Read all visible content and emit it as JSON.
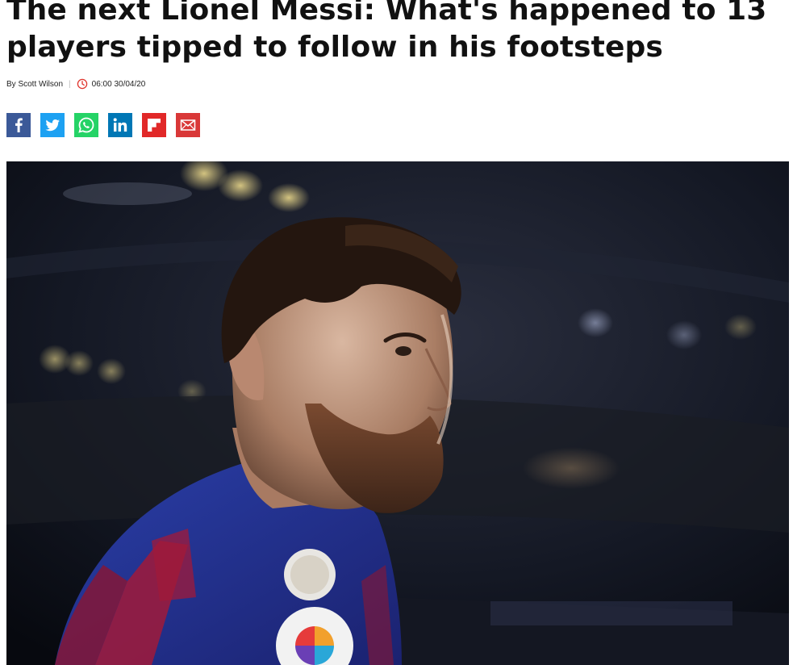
{
  "article": {
    "headline": "The next Lionel Messi: What's happened to 13 players tipped to follow in his footsteps",
    "byline_author": "By Scott Wilson",
    "byline_separator": "|",
    "timestamp": "06:00 30/04/20"
  },
  "share_buttons": [
    {
      "name": "facebook",
      "icon": "facebook-icon",
      "color": "#3b5998"
    },
    {
      "name": "twitter",
      "icon": "twitter-icon",
      "color": "#1da1f2"
    },
    {
      "name": "whatsapp",
      "icon": "whatsapp-icon",
      "color": "#25d366"
    },
    {
      "name": "linkedin",
      "icon": "linkedin-icon",
      "color": "#0077b5"
    },
    {
      "name": "flipboard",
      "icon": "flipboard-icon",
      "color": "#e12828"
    },
    {
      "name": "email",
      "icon": "email-icon",
      "color": "#d93838"
    }
  ],
  "colors": {
    "clock_accent": "#e0342c",
    "headline": "#111111"
  }
}
